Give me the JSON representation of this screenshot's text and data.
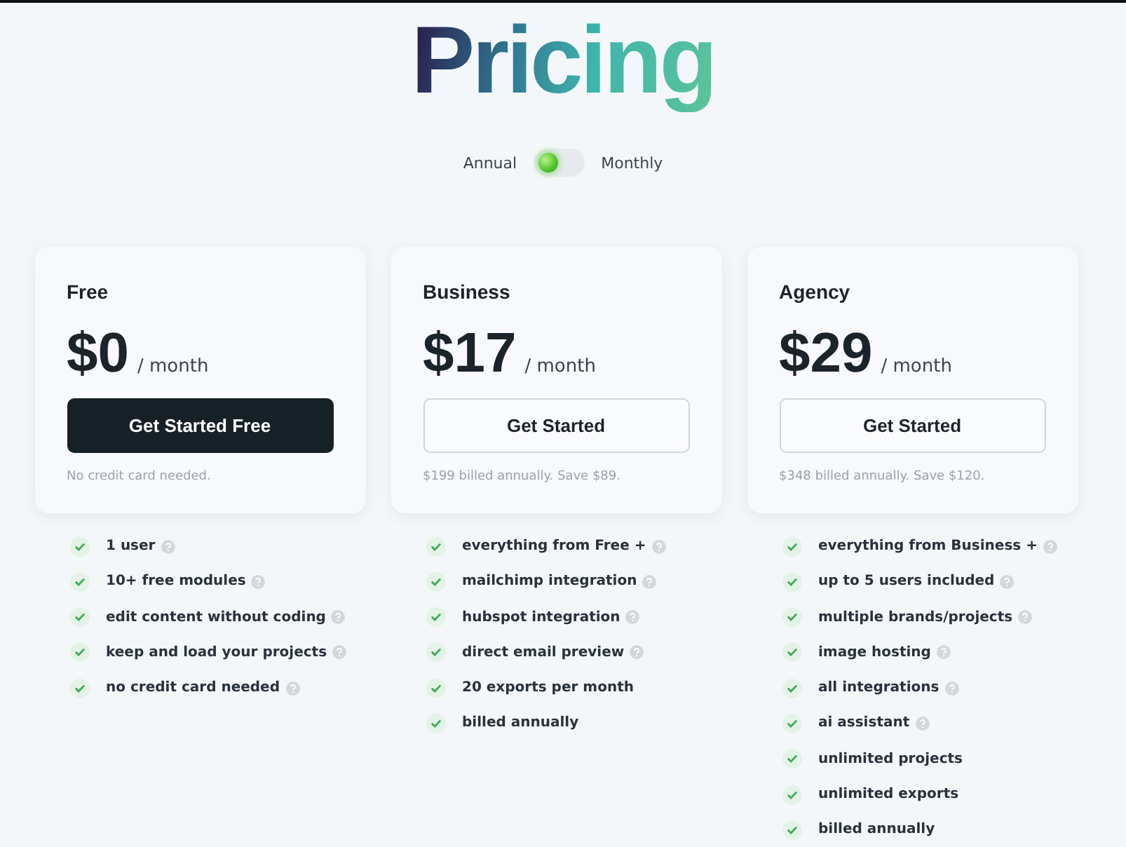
{
  "title": "Pricing",
  "billing_toggle": {
    "left_label": "Annual",
    "right_label": "Monthly",
    "on": false
  },
  "plans": [
    {
      "name": "Free",
      "price": "$0",
      "period": "/ month",
      "button": {
        "label": "Get Started Free",
        "kind": "filled"
      },
      "note": "No credit card needed.",
      "features": [
        {
          "text": "1 user",
          "info": true
        },
        {
          "text": "10+ free modules",
          "info": true
        },
        {
          "text": "edit content without coding",
          "info": true
        },
        {
          "text": "keep and load your projects",
          "info": true
        },
        {
          "text": "no credit card needed",
          "info": true
        }
      ]
    },
    {
      "name": "Business",
      "price": "$17",
      "period": "/ month",
      "button": {
        "label": "Get Started",
        "kind": "outline"
      },
      "note": "$199 billed annually. Save $89.",
      "features": [
        {
          "text": "everything from Free +",
          "info": true
        },
        {
          "text": "mailchimp integration",
          "info": true
        },
        {
          "text": "hubspot integration",
          "info": true
        },
        {
          "text": "direct email preview",
          "info": true
        },
        {
          "text": "20 exports per month",
          "info": false
        },
        {
          "text": "billed annually",
          "info": false
        }
      ]
    },
    {
      "name": "Agency",
      "price": "$29",
      "period": "/ month",
      "button": {
        "label": "Get Started",
        "kind": "outline"
      },
      "note": "$348 billed annually. Save $120.",
      "features": [
        {
          "text": "everything from Business +",
          "info": true
        },
        {
          "text": "up to 5 users included",
          "info": true
        },
        {
          "text": "multiple brands/projects",
          "info": true
        },
        {
          "text": "image hosting",
          "info": true
        },
        {
          "text": "all integrations",
          "info": true
        },
        {
          "text": "ai assistant",
          "info": true
        },
        {
          "text": "unlimited projects",
          "info": false
        },
        {
          "text": "unlimited exports",
          "info": false
        },
        {
          "text": "billed annually",
          "info": false
        }
      ]
    }
  ]
}
